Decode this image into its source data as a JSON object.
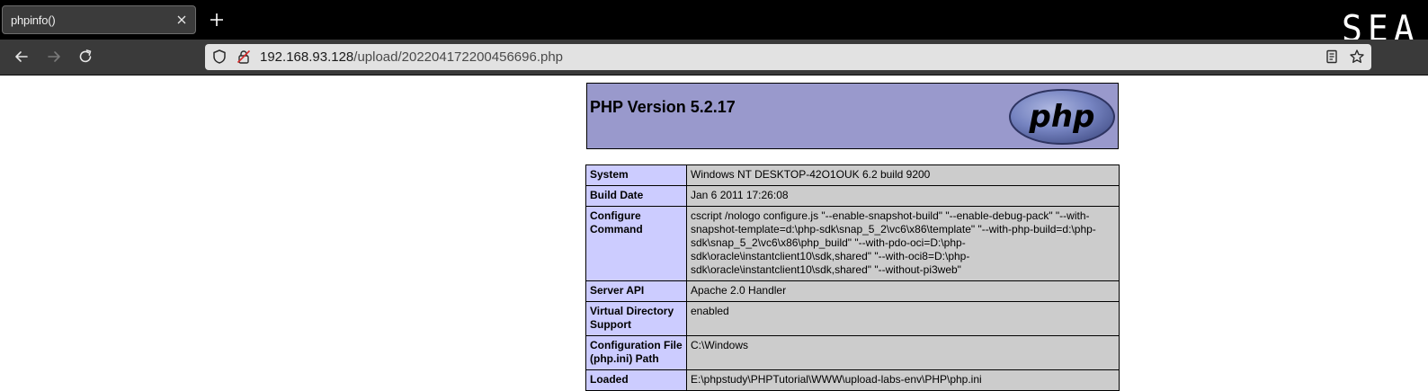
{
  "browser": {
    "tab": {
      "title": "phpinfo()"
    },
    "corner_logo": "SEA",
    "url": {
      "host": "192.168.93.128",
      "path": "/upload/202204172200456696.php"
    },
    "icons": {
      "tab_close": "close-icon",
      "new_tab": "plus-icon",
      "back": "arrow-left-icon",
      "forward": "arrow-right-icon",
      "reload": "reload-icon",
      "tracking": "shield-icon",
      "insecure": "insecure-lock-icon",
      "reader": "reader-view-icon",
      "bookmark": "star-icon"
    }
  },
  "page": {
    "header": {
      "version_title": "PHP Version 5.2.17",
      "logo_text": "php"
    },
    "rows": [
      {
        "label": "System",
        "value": "Windows NT DESKTOP-42O1OUK 6.2 build 9200"
      },
      {
        "label": "Build Date",
        "value": "Jan 6 2011 17:26:08"
      },
      {
        "label": "Configure Command",
        "value": "cscript /nologo configure.js \"--enable-snapshot-build\" \"--enable-debug-pack\" \"--with-snapshot-template=d:\\php-sdk\\snap_5_2\\vc6\\x86\\template\" \"--with-php-build=d:\\php-sdk\\snap_5_2\\vc6\\x86\\php_build\" \"--with-pdo-oci=D:\\php-sdk\\oracle\\instantclient10\\sdk,shared\" \"--with-oci8=D:\\php-sdk\\oracle\\instantclient10\\sdk,shared\" \"--without-pi3web\""
      },
      {
        "label": "Server API",
        "value": "Apache 2.0 Handler"
      },
      {
        "label": "Virtual Directory Support",
        "value": "enabled"
      },
      {
        "label": "Configuration File (php.ini) Path",
        "value": "C:\\Windows"
      },
      {
        "label": "Loaded",
        "value": "E:\\phpstudy\\PHPTutorial\\WWW\\upload-labs-env\\PHP\\php.ini"
      }
    ]
  },
  "colors": {
    "tabbar": "#000000",
    "toolbar": "#3a3a3a",
    "urlbar": "#e2e2e2",
    "php_header": "#9999cc",
    "label_cell": "#ccccff",
    "value_cell": "#cccccc",
    "php_logo": "#6c7eb7"
  }
}
